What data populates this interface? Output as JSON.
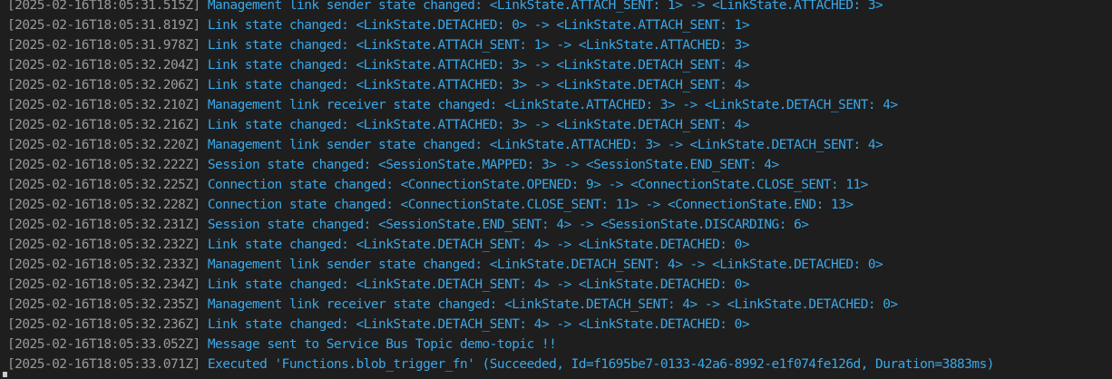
{
  "terminal": {
    "lines": [
      {
        "timestamp": "[2025-02-16T18:05:31.515Z]",
        "message": "Management link sender state changed: <LinkState.ATTACH_SENT: 1> -> <LinkState.ATTACHED: 3>"
      },
      {
        "timestamp": "[2025-02-16T18:05:31.819Z]",
        "message": "Link state changed: <LinkState.DETACHED: 0> -> <LinkState.ATTACH_SENT: 1>"
      },
      {
        "timestamp": "[2025-02-16T18:05:31.978Z]",
        "message": "Link state changed: <LinkState.ATTACH_SENT: 1> -> <LinkState.ATTACHED: 3>"
      },
      {
        "timestamp": "[2025-02-16T18:05:32.204Z]",
        "message": "Link state changed: <LinkState.ATTACHED: 3> -> <LinkState.DETACH_SENT: 4>"
      },
      {
        "timestamp": "[2025-02-16T18:05:32.206Z]",
        "message": "Link state changed: <LinkState.ATTACHED: 3> -> <LinkState.DETACH_SENT: 4>"
      },
      {
        "timestamp": "[2025-02-16T18:05:32.210Z]",
        "message": "Management link receiver state changed: <LinkState.ATTACHED: 3> -> <LinkState.DETACH_SENT: 4>"
      },
      {
        "timestamp": "[2025-02-16T18:05:32.216Z]",
        "message": "Link state changed: <LinkState.ATTACHED: 3> -> <LinkState.DETACH_SENT: 4>"
      },
      {
        "timestamp": "[2025-02-16T18:05:32.220Z]",
        "message": "Management link sender state changed: <LinkState.ATTACHED: 3> -> <LinkState.DETACH_SENT: 4>"
      },
      {
        "timestamp": "[2025-02-16T18:05:32.222Z]",
        "message": "Session state changed: <SessionState.MAPPED: 3> -> <SessionState.END_SENT: 4>"
      },
      {
        "timestamp": "[2025-02-16T18:05:32.225Z]",
        "message": "Connection state changed: <ConnectionState.OPENED: 9> -> <ConnectionState.CLOSE_SENT: 11>"
      },
      {
        "timestamp": "[2025-02-16T18:05:32.228Z]",
        "message": "Connection state changed: <ConnectionState.CLOSE_SENT: 11> -> <ConnectionState.END: 13>"
      },
      {
        "timestamp": "[2025-02-16T18:05:32.231Z]",
        "message": "Session state changed: <SessionState.END_SENT: 4> -> <SessionState.DISCARDING: 6>"
      },
      {
        "timestamp": "[2025-02-16T18:05:32.232Z]",
        "message": "Link state changed: <LinkState.DETACH_SENT: 4> -> <LinkState.DETACHED: 0>"
      },
      {
        "timestamp": "[2025-02-16T18:05:32.233Z]",
        "message": "Management link sender state changed: <LinkState.DETACH_SENT: 4> -> <LinkState.DETACHED: 0>"
      },
      {
        "timestamp": "[2025-02-16T18:05:32.234Z]",
        "message": "Link state changed: <LinkState.DETACH_SENT: 4> -> <LinkState.DETACHED: 0>"
      },
      {
        "timestamp": "[2025-02-16T18:05:32.235Z]",
        "message": "Management link receiver state changed: <LinkState.DETACH_SENT: 4> -> <LinkState.DETACHED: 0>"
      },
      {
        "timestamp": "[2025-02-16T18:05:32.236Z]",
        "message": "Link state changed: <LinkState.DETACH_SENT: 4> -> <LinkState.DETACHED: 0>"
      },
      {
        "timestamp": "[2025-02-16T18:05:33.052Z]",
        "message": "Message sent to Service Bus Topic demo-topic !!"
      },
      {
        "timestamp": "[2025-02-16T18:05:33.071Z]",
        "message": "Executed 'Functions.blob_trigger_fn' (Succeeded, Id=f1695be7-0133-42a6-8992-e1f074fe126d, Duration=3883ms)"
      }
    ]
  },
  "colors": {
    "background": "#1e1e1e",
    "timestamp": "#9a9a9a",
    "message": "#3aa8e8"
  }
}
